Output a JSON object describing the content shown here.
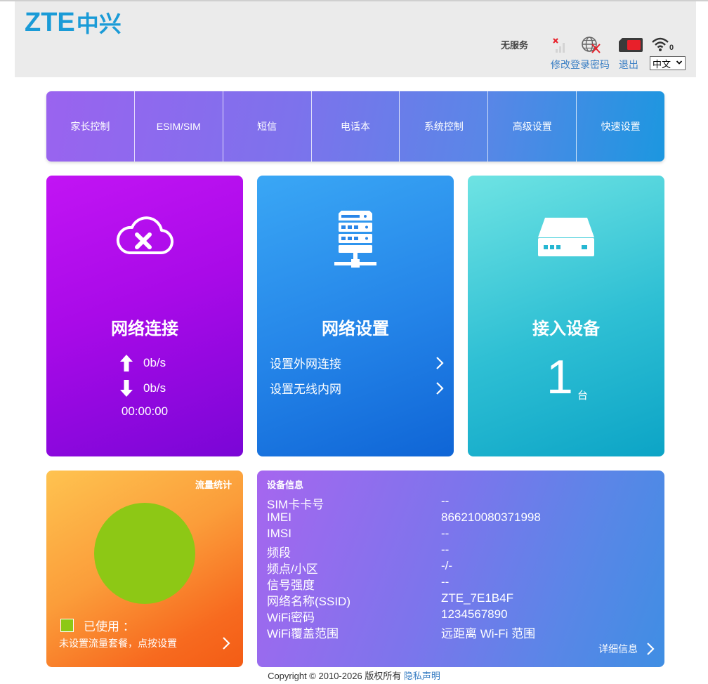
{
  "header": {
    "logo_latin": "ZTE",
    "logo_chinese": "中兴",
    "network_status": "无服务",
    "change_password": "修改登录密码",
    "logout": "退出",
    "language": "中文",
    "wifi_clients": "0"
  },
  "nav": {
    "items": [
      "家长控制",
      "ESIM/SIM",
      "短信",
      "电话本",
      "系统控制",
      "高级设置",
      "快速设置"
    ]
  },
  "connection": {
    "title": "网络连接",
    "upload": "0b/s",
    "download": "0b/s",
    "duration": "00:00:00"
  },
  "network_settings": {
    "title": "网络设置",
    "wan_link": "设置外网连接",
    "lan_link": "设置无线内网"
  },
  "devices": {
    "title": "接入设备",
    "count": "1",
    "unit": "台"
  },
  "traffic": {
    "title": "流量统计",
    "used_label": "已使用  ：",
    "note": "未设置流量套餐，点按设置"
  },
  "device_info": {
    "title": "设备信息",
    "rows": [
      {
        "k": "SIM卡卡号",
        "v": "--"
      },
      {
        "k": "IMEI",
        "v": "866210080371998"
      },
      {
        "k": "IMSI",
        "v": "--"
      },
      {
        "k": "频段",
        "v": "--"
      },
      {
        "k": "频点/小区",
        "v": "-/-"
      },
      {
        "k": "信号强度",
        "v": "--"
      },
      {
        "k": "网络名称(SSID)",
        "v": "ZTE_7E1B4F"
      },
      {
        "k": "WiFi密码",
        "v": "1234567890"
      },
      {
        "k": "WiFi覆盖范围",
        "v": "远距离 Wi-Fi 范围"
      }
    ],
    "details": "详细信息"
  },
  "footer": {
    "copyright": "Copyright © 2010-2026 版权所有 ",
    "privacy": "隐私声明"
  },
  "colors": {
    "brand": "#1a9bd7",
    "link": "#3b7fc4",
    "sim_red": "#e8202a",
    "traffic_green": "#8dc815"
  }
}
